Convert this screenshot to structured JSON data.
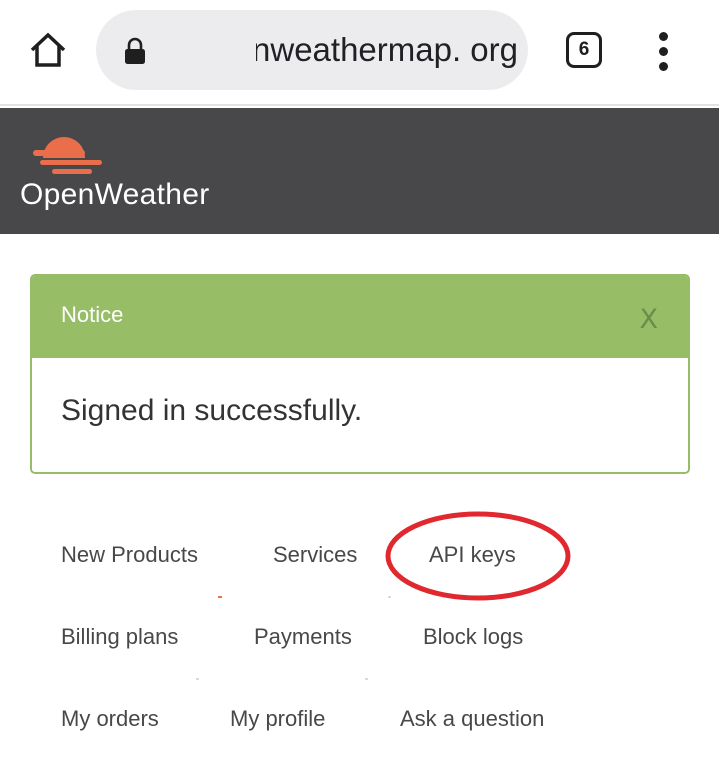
{
  "browser": {
    "url": "openweathermap. org",
    "tab_count": "6",
    "icons": [
      "home-icon",
      "lock-icon",
      "tab-switcher-icon",
      "more-vert-icon"
    ]
  },
  "site": {
    "brand": "OpenWeather",
    "header_color": "#48484a",
    "logo_color": "#eb6e4b"
  },
  "notice": {
    "title": "Notice",
    "close": "X",
    "message": "Signed in successfully.",
    "accent_color": "#97bd67"
  },
  "nav": {
    "new_products": "New Products",
    "services": "Services",
    "api_keys": "API keys",
    "billing_plans": "Billing plans",
    "payments": "Payments",
    "block_logs": "Block logs",
    "my_orders": "My orders",
    "my_profile": "My profile",
    "ask_question": "Ask a question"
  },
  "annotation": {
    "shape": "ellipse",
    "target": "API keys",
    "color": "#e0282e"
  }
}
